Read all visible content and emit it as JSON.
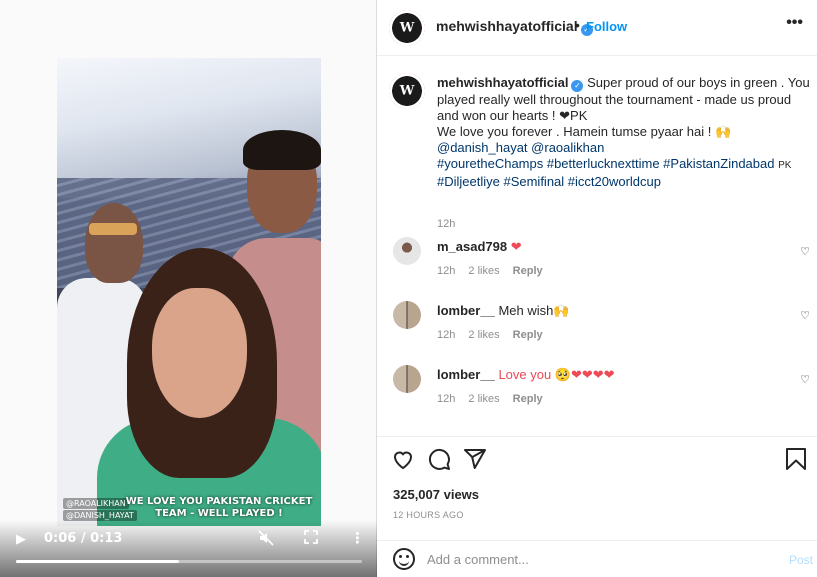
{
  "video": {
    "caption_tag_1": "@RAOALIKHAN",
    "caption_tag_2": "@DANISH_HAYAT",
    "caption_text": "WE LOVE YOU PAKISTAN CRICKET TEAM - WELL PLAYED !",
    "time": "0:06 / 0:13",
    "progress": 0.47,
    "icons": {
      "play": "play-icon",
      "mute": "volume-muted-icon",
      "fullscreen": "fullscreen-icon",
      "more": "more-vertical-icon"
    }
  },
  "header": {
    "username": "mehwishhayatofficial",
    "separator": "•",
    "follow_label": "Follow",
    "options_label": "•••",
    "avatar_letter": "W"
  },
  "caption": {
    "username": "mehwishhayatofficial",
    "line1": "Super proud of our boys in green . You played really well throughout the tournament - made us proud and won our hearts ! ❤PK",
    "line2": "We love you forever . Hamein tumse pyaar hai ! 🙌",
    "mention1": "@danish_hayat",
    "mention2": "@raoalikhan",
    "hashtags1": "#youretheChamps #betterlucknexttime #PakistanZindabad",
    "flag1": "PK",
    "hashtags2": "#Diljeetliye #Semifinal #icct20worldcup",
    "time": "12h"
  },
  "comments": [
    {
      "username": "m_asad798",
      "text": "❤",
      "time": "12h",
      "likes": "2 likes",
      "reply": "Reply"
    },
    {
      "username": "lomber__",
      "text": "Meh wish🙌",
      "time": "12h",
      "likes": "2 likes",
      "reply": "Reply"
    },
    {
      "username": "lomber__",
      "text": "Love you 🥺❤❤❤❤",
      "time": "12h",
      "likes": "2 likes",
      "reply": "Reply"
    }
  ],
  "actions": {
    "views": "325,007 views",
    "posted": "12 HOURS AGO",
    "icons": {
      "like": "heart-icon",
      "comment": "comment-icon",
      "share": "share-icon",
      "save": "bookmark-icon"
    }
  },
  "add_comment": {
    "placeholder": "Add a comment...",
    "post_label": "Post"
  },
  "colors": {
    "link": "#00376b",
    "accent": "#0095f6",
    "muted": "#8e8e8e",
    "heart": "#ed4956"
  }
}
